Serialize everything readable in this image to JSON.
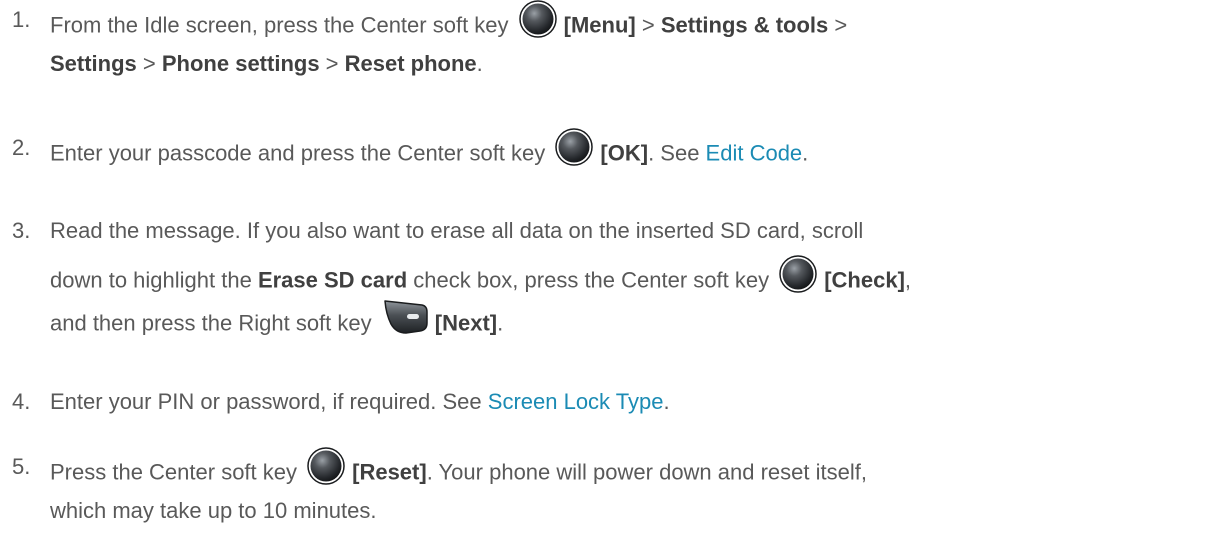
{
  "steps": [
    {
      "number": "1.",
      "line1": {
        "t1": "From the Idle screen, press the Center soft key",
        "key_label": "[Menu]",
        "sep1": " > ",
        "b2": "Settings & tools",
        "sep2": " >"
      },
      "line2": {
        "b1": "Settings",
        "sep1": " > ",
        "b2": "Phone settings",
        "sep2": " > ",
        "b3": "Reset phone",
        "end": "."
      }
    },
    {
      "number": "2.",
      "line1": {
        "t1": "Enter your passcode and press the Center soft key",
        "key_label": "[OK]",
        "t2": ". See ",
        "link": "Edit Code",
        "end": "."
      }
    },
    {
      "number": "3.",
      "line1": {
        "t1": "Read the message. If you also want to erase all data on the inserted SD card, scroll"
      },
      "line2": {
        "t1": "down to highlight the ",
        "b1": "Erase SD card",
        "t2": " check box, press the Center soft key",
        "key_label": "[Check]",
        "end": ","
      },
      "line3": {
        "t1": "and then press the Right soft key",
        "key_label": "[Next]",
        "end": "."
      }
    },
    {
      "number": "4.",
      "line1": {
        "t1": "Enter your PIN or password, if required. See ",
        "link": "Screen Lock Type",
        "end": "."
      }
    },
    {
      "number": "5.",
      "line1": {
        "t1": "Press the Center soft key",
        "key_label": "[Reset]",
        "t2": ". Your phone will power down and reset itself,"
      },
      "line2": {
        "t1": "which may take up to 10 minutes."
      }
    }
  ],
  "icons": {
    "center_key": "center-soft-key-icon",
    "right_key": "right-soft-key-icon"
  },
  "colors": {
    "text": "#595959",
    "bold": "#404040",
    "link": "#1b8bb4",
    "key_dark": "#2b2f33",
    "key_light": "#8a9096"
  }
}
